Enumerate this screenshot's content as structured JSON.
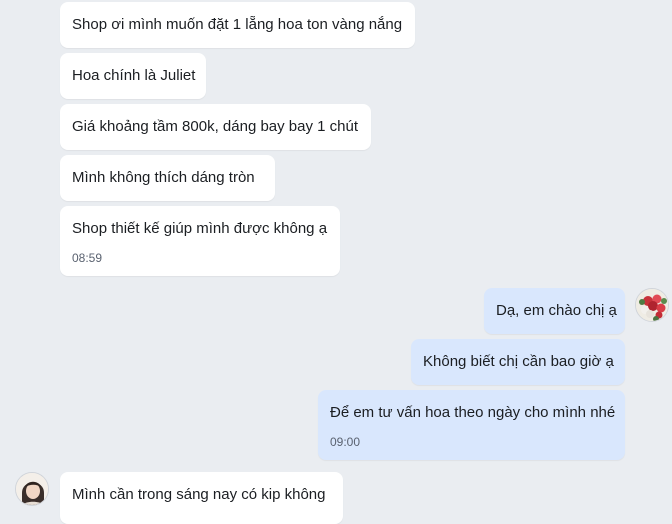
{
  "incoming_top": [
    {
      "text": "Shop ơi mình muốn đặt 1 lẵng hoa ton vàng nắng"
    },
    {
      "text": "Hoa chính là Juliet"
    },
    {
      "text": "Giá khoảng tầm 800k, dáng bay bay 1 chút"
    },
    {
      "text": "Mình không thích dáng tròn"
    },
    {
      "text": "Shop thiết kế giúp mình được không ạ",
      "time": "08:59"
    }
  ],
  "outgoing": [
    {
      "text": "Dạ, em chào chị ạ"
    },
    {
      "text": "Không biết chị cần bao giờ ạ"
    },
    {
      "text": "Để em tư vấn hoa theo ngày cho mình nhé",
      "time": "09:00"
    }
  ],
  "incoming_bottom": [
    {
      "text": "Mình cần trong sáng nay có kip không"
    }
  ],
  "avatars": {
    "shop": "flower-bouquet-avatar",
    "customer": "user-portrait-avatar"
  }
}
